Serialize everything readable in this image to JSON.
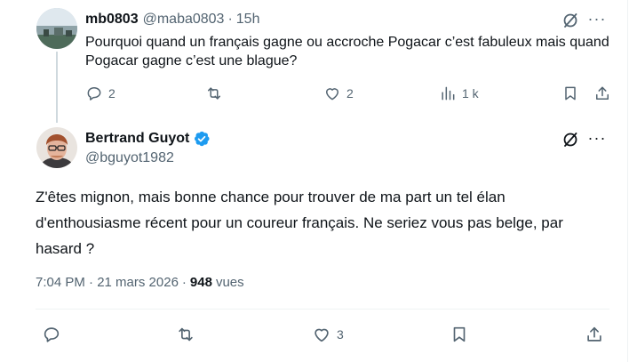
{
  "reply": {
    "display_name": "mb0803",
    "handle": "@maba0803",
    "separator": "·",
    "time": "15h",
    "text": "Pourquoi quand un français gagne ou accroche Pogacar c’est fabuleux mais quand Pogacar gagne c’est une blague?",
    "actions": {
      "replies": "2",
      "retweets": "",
      "likes": "2",
      "views": "1 k"
    }
  },
  "main": {
    "display_name": "Bertrand Guyot",
    "handle": "@bguyot1982",
    "text": "Z'êtes mignon, mais bonne chance pour trouver de ma part un tel élan d'enthousiasme récent pour un coureur français. Ne seriez vous pas belge, par hasard ?",
    "timestamp": "7:04 PM · 21 mars 2026",
    "meta_separator": "·",
    "views_count": "948",
    "views_label": "vues",
    "actions": {
      "replies": "",
      "retweets": "",
      "likes": "3"
    }
  },
  "colors": {
    "text_primary": "#0f1419",
    "text_secondary": "#536471",
    "verified_blue": "#1d9bf0",
    "thread_line": "#cfd9de",
    "divider": "#eff3f4"
  },
  "icons": [
    "reply-icon",
    "retweet-icon",
    "like-icon",
    "views-icon",
    "bookmark-icon",
    "share-icon",
    "grok-icon",
    "more-icon",
    "verified-badge-icon"
  ]
}
